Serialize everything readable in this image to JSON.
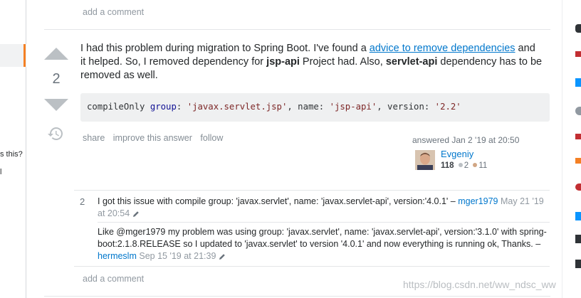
{
  "top": {
    "add_comment": "add a comment"
  },
  "sidebar": {
    "partial_text_1": "s this?",
    "partial_text_2": "l"
  },
  "answer": {
    "score": "2",
    "body": {
      "p1": "I had this problem during migration to Spring Boot. I've found a ",
      "link": "advice to remove dependencies",
      "p2": " and it helped. So, I removed dependency for ",
      "b1": "jsp-api",
      "p3": " Project had. Also, ",
      "b2": "servlet-api",
      "p4": " dependency has to be removed as well."
    },
    "code": {
      "t1": "compileOnly ",
      "k1": "group",
      "t2": ": ",
      "s1": "'javax.servlet.jsp'",
      "t3": ", name: ",
      "s2": "'jsp-api'",
      "t4": ", version: ",
      "s3": "'2.2'"
    },
    "menu": {
      "share": "share",
      "improve": "improve this answer",
      "follow": "follow"
    },
    "user": {
      "answered": "answered Jan 2 '19 at 20:50",
      "name": "Evgeniy",
      "rep": "118",
      "silver": "2",
      "bronze": "11"
    }
  },
  "comments": [
    {
      "score": "2",
      "text": "I got this issue with compile group: 'javax.servlet', name: 'javax.servlet-api', version:'4.0.1' – ",
      "user": "mger1979",
      "date": "May 21 '19 at 20:54"
    },
    {
      "score": "",
      "text": "Like @mger1979 my problem was using group: 'javax.servlet', name: 'javax.servlet-api', version:'3.1.0' with spring-boot:2.1.8.RELEASE so I updated to 'javax.servlet' to version '4.0.1' and now everything is running ok, Thanks. – ",
      "user": "hermeslm",
      "date": "Sep 15 '19 at 21:39"
    }
  ],
  "bottom": {
    "add_comment": "add a comment"
  },
  "watermark": "https://blog.csdn.net/ww_ndsc_ww",
  "colors": {
    "accent": "#f48024",
    "link": "#0077cc",
    "code_bg": "#eff0f1",
    "silver": "#bbc0c4",
    "bronze": "#d1a684"
  }
}
